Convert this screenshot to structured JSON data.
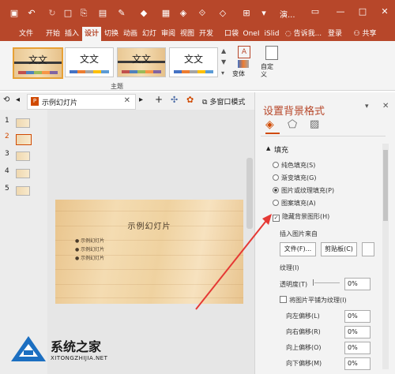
{
  "titlebar": {
    "window_title": "演...",
    "qat_icons": [
      "save-icon",
      "undo-icon",
      "redo-icon",
      "new-slide-icon",
      "format-painter-icon",
      "text-box-icon",
      "pen-icon",
      "shapes-icon",
      "arrange-icon",
      "more-icon"
    ]
  },
  "ribbon": {
    "tabs": [
      "文件",
      "开始",
      "插入",
      "设计",
      "切换",
      "动画",
      "幻灯",
      "审阅",
      "视图",
      "开发",
      "口袋",
      "OneI",
      "iSlid"
    ],
    "active_tab": "设计",
    "tell_me": "告诉我...",
    "login": "登录",
    "share": "共享",
    "theme_sample_text": "文文",
    "theme_group_label": "主题",
    "variants_label": "变体",
    "customize_label": "自定\n义"
  },
  "pane_tabs": {
    "doc_tab": "示例幻灯片",
    "multi_window": "多窗口模式"
  },
  "thumbnails": [
    "1",
    "2",
    "3",
    "4",
    "5"
  ],
  "slide": {
    "title": "示例幻灯片",
    "bullets": [
      "● 示例幻灯片",
      "● 示例幻灯片",
      "● 示例幻灯片"
    ]
  },
  "format_pane": {
    "title": "设置背景格式",
    "section_fill": "填充",
    "options": [
      "纯色填充(S)",
      "渐变填充(G)",
      "图片或纹理填充(P)",
      "图案填充(A)"
    ],
    "selected_option": 2,
    "hide_bg": "隐藏背景图形(H)",
    "insert_from": "插入图片来自",
    "file_btn": "文件(F)...",
    "clipboard_btn": "剪贴板(C)",
    "texture_label": "纹理(I)",
    "transparency_label": "透明度(T)",
    "transparency_value": "0%",
    "tile_label": "将图片平铺为纹理(I)",
    "offset_left": "向左偏移(L)",
    "offset_right": "向右偏移(R)",
    "offset_up": "向上偏移(O)",
    "offset_down": "向下偏移(M)",
    "offset_values": [
      "0%",
      "0%",
      "0%",
      "0%"
    ]
  },
  "watermark": {
    "name": "系统之家",
    "url": "XITONGZHIJIA.NET"
  },
  "colors": {
    "accent": "#b7472a",
    "arrow": "#e53935"
  }
}
